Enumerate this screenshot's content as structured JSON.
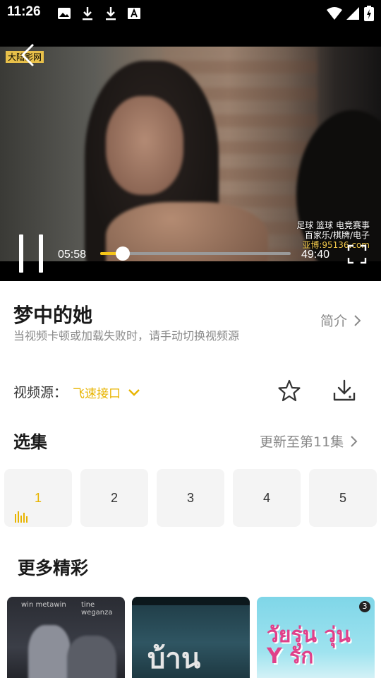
{
  "status_bar": {
    "time": "11:26",
    "icons": [
      "image-icon",
      "download-icon",
      "download-icon",
      "font-icon",
      "wifi-icon",
      "signal-icon",
      "battery-charging-icon"
    ]
  },
  "player": {
    "current_time": "05:58",
    "duration": "49:40",
    "progress": 0.12,
    "watermark_tag": "大陆影网",
    "overlay_ad": {
      "line1": "足球 篮球 电竞赛事",
      "line2": "百家乐/棋牌/电子",
      "line3": "亚博:95136.com"
    },
    "accent_color": "#f5c518"
  },
  "info": {
    "title": "梦中的她",
    "intro_label": "简介",
    "hint": "当视频卡顿或加载失败时，请手动切换视频源"
  },
  "source": {
    "label": "视频源：",
    "value": "飞速接口",
    "accent_color": "#e8b400"
  },
  "episodes": {
    "title": "选集",
    "update_text": "更新至第11集",
    "items": [
      "1",
      "2",
      "3",
      "4",
      "5"
    ],
    "active_index": 0
  },
  "more": {
    "title": "更多精彩",
    "posters": [
      {
        "caption_left": "win metawin",
        "caption_right": "tine weganza"
      },
      {
        "title_art": "บ้าน"
      },
      {
        "title_art": "วัยรุ่น วุ่น Y รัก",
        "badge": "3"
      }
    ]
  }
}
